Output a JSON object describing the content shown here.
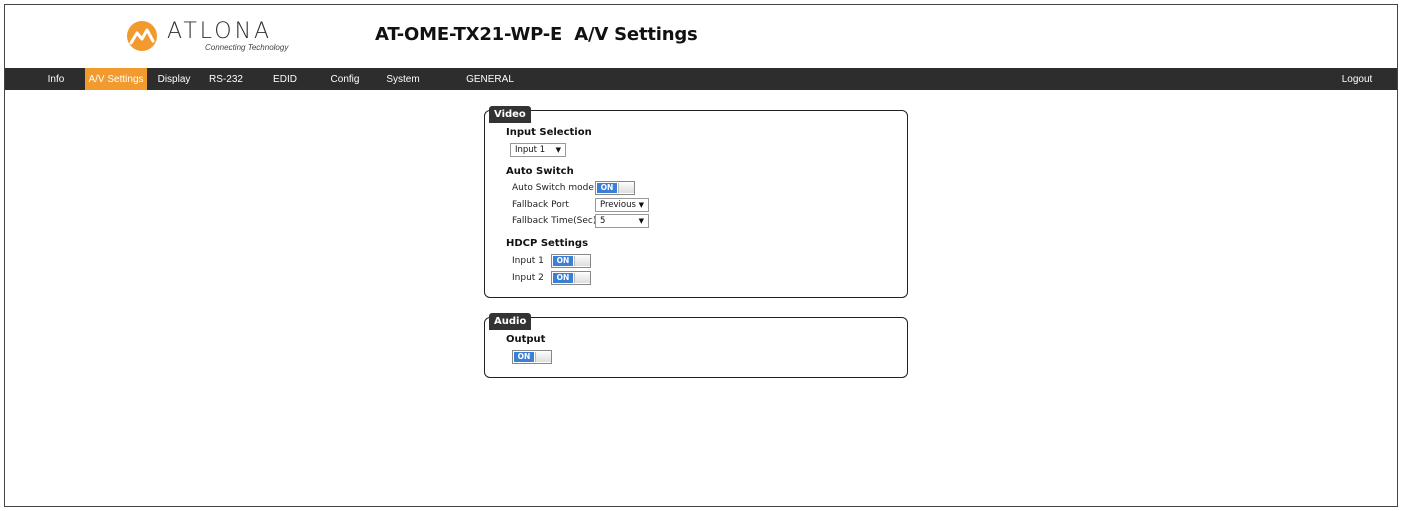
{
  "header": {
    "logo_word": "ATLONA",
    "logo_tagline": "Connecting Technology",
    "title": "AT-OME-TX21-WP-E  A/V Settings"
  },
  "nav": {
    "items": [
      {
        "label": "Info"
      },
      {
        "label": "A/V Settings",
        "active": true
      },
      {
        "label": "Display"
      },
      {
        "label": "RS-232"
      },
      {
        "label": "EDID"
      },
      {
        "label": "Config"
      },
      {
        "label": "System"
      },
      {
        "label": "GENERAL"
      }
    ],
    "logout": "Logout"
  },
  "video": {
    "tab": "Video",
    "input_selection": {
      "title": "Input Selection",
      "value": "Input 1"
    },
    "auto_switch": {
      "title": "Auto Switch",
      "mode_label": "Auto Switch mode",
      "mode_state": "ON",
      "fallback_port_label": "Fallback Port",
      "fallback_port_value": "Previous",
      "fallback_time_label": "Fallback Time(Sec)",
      "fallback_time_value": "5"
    },
    "hdcp": {
      "title": "HDCP Settings",
      "input1_label": "Input 1",
      "input1_state": "ON",
      "input2_label": "Input 2",
      "input2_state": "ON"
    }
  },
  "audio": {
    "tab": "Audio",
    "output_title": "Output",
    "output_state": "ON"
  },
  "colors": {
    "nav_bg": "#2d2d2d",
    "nav_active": "#f29a2e",
    "toggle_on": "#3c7fd6",
    "logo_orange": "#f29a2e"
  }
}
